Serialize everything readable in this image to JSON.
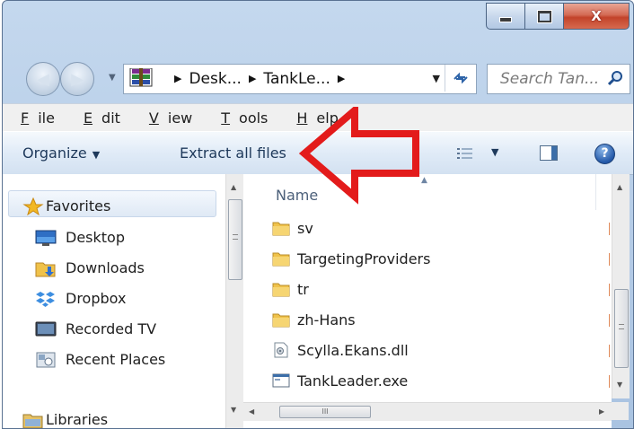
{
  "window": {
    "minimize_glyph": "minimize-icon",
    "maximize_glyph": "maximize-icon",
    "close_label": "X"
  },
  "address": {
    "crumbs": [
      "Desk...",
      "TankLe..."
    ],
    "search_placeholder": "Search Tan..."
  },
  "menu": {
    "items": [
      {
        "label": "File",
        "accel": "F"
      },
      {
        "label": "Edit",
        "accel": "E"
      },
      {
        "label": "View",
        "accel": "V"
      },
      {
        "label": "Tools",
        "accel": "T"
      },
      {
        "label": "Help",
        "accel": "H"
      }
    ]
  },
  "toolbar": {
    "organize_label": "Organize",
    "extract_label": "Extract all files"
  },
  "navpane": {
    "favorites_label": "Favorites",
    "items": [
      {
        "label": "Desktop",
        "icon": "desktop-icon"
      },
      {
        "label": "Downloads",
        "icon": "downloads-icon"
      },
      {
        "label": "Dropbox",
        "icon": "dropbox-icon"
      },
      {
        "label": "Recorded TV",
        "icon": "recorded-tv-icon"
      },
      {
        "label": "Recent Places",
        "icon": "recent-places-icon"
      }
    ],
    "libraries_label": "Libraries"
  },
  "files": {
    "column_name": "Name",
    "rows": [
      {
        "label": "sv",
        "type": "folder"
      },
      {
        "label": "TargetingProviders",
        "type": "folder"
      },
      {
        "label": "tr",
        "type": "folder"
      },
      {
        "label": "zh-Hans",
        "type": "folder"
      },
      {
        "label": "Scylla.Ekans.dll",
        "type": "dll"
      },
      {
        "label": "TankLeader.exe",
        "type": "exe"
      }
    ]
  },
  "annotation": {
    "color": "#e31b1b",
    "shape": "left-arrow"
  }
}
